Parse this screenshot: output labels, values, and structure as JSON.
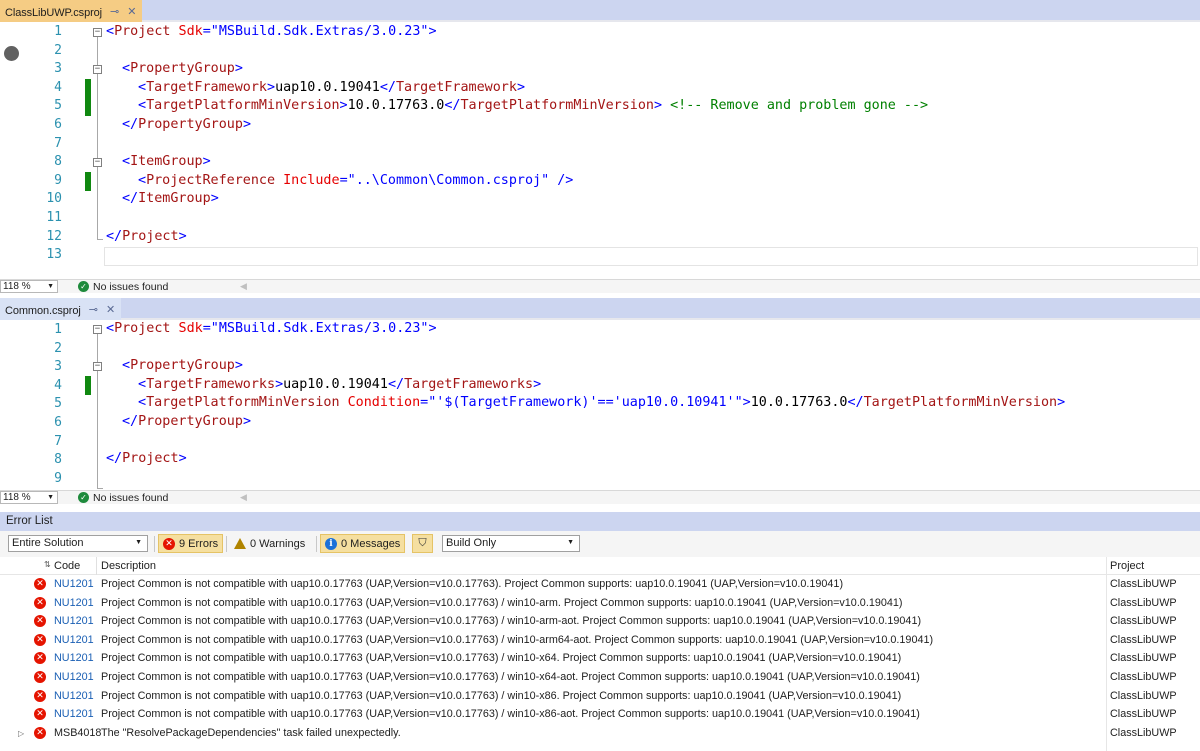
{
  "pane1": {
    "tab_title": "ClassLibUWP.csproj",
    "tab_pin": "⊸",
    "tab_close": "✕",
    "zoom": "118 %",
    "status": "No issues found",
    "lines": [
      "1",
      "2",
      "3",
      "4",
      "5",
      "6",
      "7",
      "8",
      "9",
      "10",
      "11",
      "12",
      "13"
    ]
  },
  "pane2": {
    "tab_title": "Common.csproj",
    "tab_pin": "⊸",
    "tab_close": "✕",
    "zoom": "118 %",
    "status": "No issues found",
    "lines": [
      "1",
      "2",
      "3",
      "4",
      "5",
      "6",
      "7",
      "8",
      "9"
    ]
  },
  "code1": {
    "l1": {
      "open": "<",
      "el": "Project",
      "at": " Sdk",
      "eq": "=\"",
      "val": "MSBuild.Sdk.Extras/3.0.23",
      "close": "\">"
    },
    "l3": {
      "open": "<",
      "el": "PropertyGroup",
      "close": ">"
    },
    "l4": {
      "open": "<",
      "el": "TargetFramework",
      "mid": ">",
      "txt": "uap10.0.19041",
      "open2": "</",
      "el2": "TargetFramework",
      "close": ">"
    },
    "l5": {
      "open": "<",
      "el": "TargetPlatformMinVersion",
      "mid": ">",
      "txt": "10.0.17763.0",
      "open2": "</",
      "el2": "TargetPlatformMinVersion",
      "close": ">",
      "com": " <!-- Remove and problem gone -->"
    },
    "l6": {
      "open": "</",
      "el": "PropertyGroup",
      "close": ">"
    },
    "l8": {
      "open": "<",
      "el": "ItemGroup",
      "close": ">"
    },
    "l9": {
      "open": "<",
      "el": "ProjectReference",
      "at": " Include",
      "eq": "=\"",
      "val": "..\\Common\\Common.csproj",
      "close": "\" />"
    },
    "l10": {
      "open": "</",
      "el": "ItemGroup",
      "close": ">"
    },
    "l12": {
      "open": "</",
      "el": "Project",
      "close": ">"
    }
  },
  "code2": {
    "l1": {
      "open": "<",
      "el": "Project",
      "at": " Sdk",
      "eq": "=\"",
      "val": "MSBuild.Sdk.Extras/3.0.23",
      "close": "\">"
    },
    "l3": {
      "open": "<",
      "el": "PropertyGroup",
      "close": ">"
    },
    "l4": {
      "open": "<",
      "el": "TargetFrameworks",
      "mid": ">",
      "txt": "uap10.0.19041",
      "open2": "</",
      "el2": "TargetFrameworks",
      "close": ">"
    },
    "l5": {
      "open": "<",
      "el": "TargetPlatformMinVersion",
      "at": " Condition",
      "eq": "=\"",
      "val": "'$(TargetFramework)'=='uap10.0.10941'",
      "mid": "\">",
      "txt": "10.0.17763.0",
      "open2": "</",
      "el2": "TargetPlatformMinVersion",
      "close": ">"
    },
    "l6": {
      "open": "</",
      "el": "PropertyGroup",
      "close": ">"
    },
    "l8": {
      "open": "</",
      "el": "Project",
      "close": ">"
    }
  },
  "error_list": {
    "title": "Error List",
    "scope": "Entire Solution",
    "errors_label": "9 Errors",
    "warnings_label": "0 Warnings",
    "messages_label": "0 Messages",
    "build_filter": "Build Only",
    "columns": {
      "code": "Code",
      "description": "Description",
      "project": "Project"
    },
    "rows": [
      {
        "code": "NU1201",
        "desc": "Project Common is not compatible with uap10.0.17763 (UAP,Version=v10.0.17763). Project Common supports: uap10.0.19041 (UAP,Version=v10.0.19041)",
        "project": "ClassLibUWP"
      },
      {
        "code": "NU1201",
        "desc": "Project Common is not compatible with uap10.0.17763 (UAP,Version=v10.0.17763) / win10-arm. Project Common supports: uap10.0.19041 (UAP,Version=v10.0.19041)",
        "project": "ClassLibUWP"
      },
      {
        "code": "NU1201",
        "desc": "Project Common is not compatible with uap10.0.17763 (UAP,Version=v10.0.17763) / win10-arm-aot. Project Common supports: uap10.0.19041 (UAP,Version=v10.0.19041)",
        "project": "ClassLibUWP"
      },
      {
        "code": "NU1201",
        "desc": "Project Common is not compatible with uap10.0.17763 (UAP,Version=v10.0.17763) / win10-arm64-aot. Project Common supports: uap10.0.19041 (UAP,Version=v10.0.19041)",
        "project": "ClassLibUWP"
      },
      {
        "code": "NU1201",
        "desc": "Project Common is not compatible with uap10.0.17763 (UAP,Version=v10.0.17763) / win10-x64. Project Common supports: uap10.0.19041 (UAP,Version=v10.0.19041)",
        "project": "ClassLibUWP"
      },
      {
        "code": "NU1201",
        "desc": "Project Common is not compatible with uap10.0.17763 (UAP,Version=v10.0.17763) / win10-x64-aot. Project Common supports: uap10.0.19041 (UAP,Version=v10.0.19041)",
        "project": "ClassLibUWP"
      },
      {
        "code": "NU1201",
        "desc": "Project Common is not compatible with uap10.0.17763 (UAP,Version=v10.0.17763) / win10-x86. Project Common supports: uap10.0.19041 (UAP,Version=v10.0.19041)",
        "project": "ClassLibUWP"
      },
      {
        "code": "NU1201",
        "desc": "Project Common is not compatible with uap10.0.17763 (UAP,Version=v10.0.17763) / win10-x86-aot. Project Common supports: uap10.0.19041 (UAP,Version=v10.0.19041)",
        "project": "ClassLibUWP"
      },
      {
        "code": "MSB4018",
        "desc": "The \"ResolvePackageDependencies\" task failed unexpectedly.",
        "project": "ClassLibUWP"
      }
    ]
  },
  "icons": {
    "error": "error-icon",
    "warning": "warning-icon",
    "info": "info-icon",
    "filter": "filter-icon",
    "breakpoint": "breakpoint-icon",
    "check": "check-icon"
  },
  "colors": {
    "tab_active": "#f5cc84",
    "change_marker": "#108810",
    "error_red": "#e51400",
    "element": "#a31515",
    "attribute": "#e50000",
    "comment": "#008000"
  }
}
